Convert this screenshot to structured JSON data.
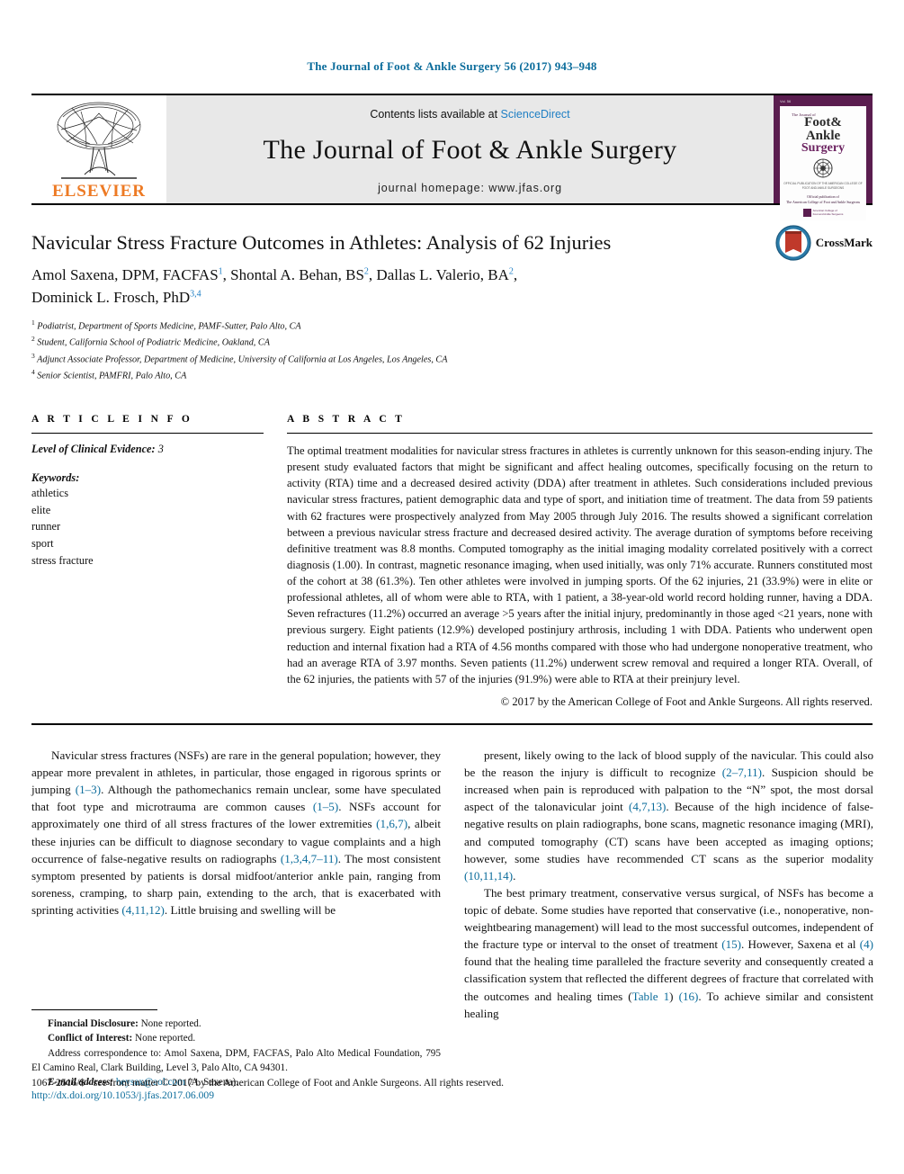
{
  "running_head": "The Journal of Foot & Ankle Surgery 56 (2017) 943–948",
  "masthead": {
    "publisher_name": "ELSEVIER",
    "contents_prefix": "Contents lists available at ",
    "contents_link": "ScienceDirect",
    "journal_title": "The Journal of Foot & Ankle Surgery",
    "homepage_label": "journal homepage: www.jfas.org",
    "cover": {
      "tag": "Vol. 56",
      "pre": "The\nJournal\nof",
      "line1": "Foot&",
      "line2": "Ankle",
      "line3": "Surgery",
      "fine": "OFFICIAL PUBLICATION OF THE AMERICAN COLLEGE OF FOOT AND ANKLE SURGEONS",
      "fine2": "Official publication of\nThe American College of Foot and Ankle Surgeons",
      "logo_text": "American College of\nFoot and Ankle Surgeons"
    }
  },
  "article": {
    "title": "Navicular Stress Fracture Outcomes in Athletes: Analysis of 62 Injuries",
    "authors": [
      {
        "name": "Amol Saxena, DPM, FACFAS",
        "sup": "1"
      },
      {
        "name": "Shontal A. Behan, BS",
        "sup": "2"
      },
      {
        "name": "Dallas L. Valerio, BA",
        "sup": "2"
      },
      {
        "name": "Dominick L. Frosch, PhD",
        "sup": "3,4"
      }
    ],
    "affiliations": [
      {
        "sup": "1",
        "text": "Podiatrist, Department of Sports Medicine, PAMF-Sutter, Palo Alto, CA"
      },
      {
        "sup": "2",
        "text": "Student, California School of Podiatric Medicine, Oakland, CA"
      },
      {
        "sup": "3",
        "text": "Adjunct Associate Professor, Department of Medicine, University of California at Los Angeles, Los Angeles, CA"
      },
      {
        "sup": "4",
        "text": "Senior Scientist, PAMFRI, Palo Alto, CA"
      }
    ],
    "crossmark_label": "CrossMark"
  },
  "article_info": {
    "heading": "A R T I C L E   I N F O",
    "level_label": "Level of Clinical Evidence:",
    "level_value": "3",
    "keywords_label": "Keywords:",
    "keywords": [
      "athletics",
      "elite",
      "runner",
      "sport",
      "stress fracture"
    ]
  },
  "abstract": {
    "heading": "A B S T R A C T",
    "text": "The optimal treatment modalities for navicular stress fractures in athletes is currently unknown for this season-ending injury. The present study evaluated factors that might be significant and affect healing outcomes, specifically focusing on the return to activity (RTA) time and a decreased desired activity (DDA) after treatment in athletes. Such considerations included previous navicular stress fractures, patient demographic data and type of sport, and initiation time of treatment. The data from 59 patients with 62 fractures were prospectively analyzed from May 2005 through July 2016. The results showed a significant correlation between a previous navicular stress fracture and decreased desired activity. The average duration of symptoms before receiving definitive treatment was 8.8 months. Computed tomography as the initial imaging modality correlated positively with a correct diagnosis (1.00). In contrast, magnetic resonance imaging, when used initially, was only 71% accurate. Runners constituted most of the cohort at 38 (61.3%). Ten other athletes were involved in jumping sports. Of the 62 injuries, 21 (33.9%) were in elite or professional athletes, all of whom were able to RTA, with 1 patient, a 38-year-old world record holding runner, having a DDA. Seven refractures (11.2%) occurred an average >5 years after the initial injury, predominantly in those aged <21 years, none with previous surgery. Eight patients (12.9%) developed postinjury arthrosis, including 1 with DDA. Patients who underwent open reduction and internal fixation had a RTA of 4.56 months compared with those who had undergone nonoperative treatment, who had an average RTA of 3.97 months. Seven patients (11.2%) underwent screw removal and required a longer RTA. Overall, of the 62 injuries, the patients with 57 of the injuries (91.9%) were able to RTA at their preinjury level.",
    "copyright": "© 2017 by the American College of Foot and Ankle Surgeons. All rights reserved."
  },
  "body": {
    "left_paragraphs": [
      {
        "segments": [
          {
            "t": "Navicular stress fractures (NSFs) are rare in the general population; however, they appear more prevalent in athletes, in particular, those engaged in rigorous sprints or jumping ",
            "k": "plain"
          },
          {
            "t": "(1–3)",
            "k": "ref"
          },
          {
            "t": ". Although the pathomechanics remain unclear, some have speculated that foot type and microtrauma are common causes ",
            "k": "plain"
          },
          {
            "t": "(1–5)",
            "k": "ref"
          },
          {
            "t": ". NSFs account for approximately one third of all stress fractures of the lower extremities ",
            "k": "plain"
          },
          {
            "t": "(1,6,7)",
            "k": "ref"
          },
          {
            "t": ", albeit these injuries can be difficult to diagnose secondary to vague complaints and a high occurrence of false-negative results on radiographs ",
            "k": "plain"
          },
          {
            "t": "(1,3,4,7–11)",
            "k": "ref"
          },
          {
            "t": ". The most consistent symptom presented by patients is dorsal midfoot/anterior ankle pain, ranging from soreness, cramping, to sharp pain, extending to the arch, that is exacerbated with sprinting activities ",
            "k": "plain"
          },
          {
            "t": "(4,11,12)",
            "k": "ref"
          },
          {
            "t": ". Little bruising and swelling will be",
            "k": "plain"
          }
        ]
      }
    ],
    "right_paragraphs": [
      {
        "segments": [
          {
            "t": "present, likely owing to the lack of blood supply of the navicular. This could also be the reason the injury is difficult to recognize ",
            "k": "plain"
          },
          {
            "t": "(2–7,11)",
            "k": "ref"
          },
          {
            "t": ". Suspicion should be increased when pain is reproduced with palpation to the “N” spot, the most dorsal aspect of the talonavicular joint ",
            "k": "plain"
          },
          {
            "t": "(4,7,13)",
            "k": "ref"
          },
          {
            "t": ". Because of the high incidence of false-negative results on plain radiographs, bone scans, magnetic resonance imaging (MRI), and computed tomography (CT) scans have been accepted as imaging options; however, some studies have recommended CT scans as the superior modality ",
            "k": "plain"
          },
          {
            "t": "(10,11,14)",
            "k": "ref"
          },
          {
            "t": ".",
            "k": "plain"
          }
        ]
      },
      {
        "segments": [
          {
            "t": "The best primary treatment, conservative versus surgical, of NSFs has become a topic of debate. Some studies have reported that conservative (i.e., nonoperative, non-weightbearing management) will lead to the most successful outcomes, independent of the fracture type or interval to the onset of treatment ",
            "k": "plain"
          },
          {
            "t": "(15)",
            "k": "ref"
          },
          {
            "t": ". However, Saxena et al ",
            "k": "plain"
          },
          {
            "t": "(4)",
            "k": "ref"
          },
          {
            "t": " found that the healing time paralleled the fracture severity and consequently created a classification system that reflected the different degrees of fracture that correlated with the outcomes and healing times (",
            "k": "plain"
          },
          {
            "t": "Table 1",
            "k": "ref"
          },
          {
            "t": ") ",
            "k": "plain"
          },
          {
            "t": "(16)",
            "k": "ref"
          },
          {
            "t": ". To achieve similar and consistent healing",
            "k": "plain"
          }
        ]
      }
    ]
  },
  "footnotes": {
    "financial_label": "Financial Disclosure:",
    "financial_value": " None reported.",
    "conflict_label": "Conflict of Interest:",
    "conflict_value": " None reported.",
    "address_text": "Address correspondence to: Amol Saxena, DPM, FACFAS, Palo Alto Medical Foundation, 795 El Camino Real, Clark Building, Level 3, Palo Alto, CA 94301.",
    "email_label": "E-mail address:",
    "email": "heysax@aol.com",
    "email_suffix": " (A. Saxena)."
  },
  "bottom": {
    "issn_line": "1067-2516/$ - see front matter © 2017 by the American College of Foot and Ankle Surgeons. All rights reserved.",
    "doi": "http://dx.doi.org/10.1053/j.jfas.2017.06.009"
  },
  "colors": {
    "link_blue": "#0b6c9b",
    "sciencedirect_blue": "#1f7fc4",
    "elsevier_orange": "#ED7A24",
    "cover_purple": "#5a1d4f",
    "band_gray": "#e8e8e8"
  }
}
